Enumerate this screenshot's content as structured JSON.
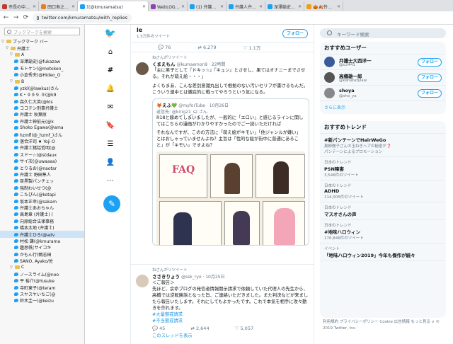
{
  "browser": {
    "tabs": [
      {
        "title": "市長の中止理由ひ",
        "color": "#c0392b"
      },
      {
        "title": "田口寿之介とか藤",
        "color": "#e67e22"
      },
      {
        "title": "ｴ(@kmuramatsu)",
        "color": "#1da1f2",
        "active": true
      },
      {
        "title": "WebLOG 弁護士中村",
        "color": "#8e44ad"
      },
      {
        "title": "(1) 弁護人弁護士",
        "color": "#1da1f2"
      },
      {
        "title": "弁護人弁護士実",
        "color": "#1da1f2"
      },
      {
        "title": "深澤諭史(@fukazaw",
        "color": "#1da1f2"
      },
      {
        "title": "🎃🍂怜奈 富冨口",
        "color": "#f39c12"
      }
    ],
    "url": "twitter.com/kmuramatsu/with_replies"
  },
  "bookmarks": {
    "search_placeholder": "ブックマークを検索",
    "items": [
      {
        "label": "ブックマーク バー",
        "indent": 0,
        "folder": true,
        "exp": "▽"
      },
      {
        "label": "弁護士",
        "indent": 1,
        "folder": true,
        "exp": "▽"
      },
      {
        "label": "A",
        "indent": 2,
        "folder": true,
        "exp": "▽"
      },
      {
        "label": "深澤諭史(@fukazaw",
        "indent": 3
      },
      {
        "label": "モトケン(@motoken_",
        "indent": 3
      },
      {
        "label": "小倉秀夫(@Hideo_O",
        "indent": 3
      },
      {
        "label": "B",
        "indent": 2,
        "folder": true,
        "exp": "▽"
      },
      {
        "label": "yzkl(@lawkus)さん",
        "indent": 3
      },
      {
        "label": "K・９９９.９(@k9",
        "indent": 3
      },
      {
        "label": "森久仁大英(@kis",
        "indent": 3
      },
      {
        "label": "ココテン刑事弁護士",
        "indent": 3
      },
      {
        "label": "弁護士 秋葉原",
        "indent": 3
      },
      {
        "label": "弁護士神前元(@k",
        "indent": 3
      },
      {
        "label": "Shoko Egawa(@ama",
        "indent": 3
      },
      {
        "label": "hzmfl(@_hzmf_)さん",
        "indent": 3
      },
      {
        "label": "落合洋司 ♦ Yoji O",
        "indent": 3
      },
      {
        "label": "弁護士猪話哲明(@",
        "indent": 3
      },
      {
        "label": "スドー☆(@stdaux",
        "indent": 3
      },
      {
        "label": "サイ次(@uwaaaa)",
        "indent": 3
      },
      {
        "label": "とりるお(@naotar",
        "indent": 3
      },
      {
        "label": "弁護士 野田隼人",
        "indent": 3
      },
      {
        "label": "目黒製パンチェッ",
        "indent": 3
      },
      {
        "label": "強制わいせつ(@",
        "indent": 3
      },
      {
        "label": "こたぴん(@kotapi",
        "indent": 3
      },
      {
        "label": "坂本正幸(@sakam",
        "indent": 3
      },
      {
        "label": "弁護士あおちゃん",
        "indent": 3
      },
      {
        "label": "高島章 (弁護士) (",
        "indent": 3
      },
      {
        "label": "向原総合法律事務",
        "indent": 3
      },
      {
        "label": "橋本太地 (弁護士)",
        "indent": 3
      },
      {
        "label": "弁護士ひろ(@adv",
        "indent": 3,
        "selected": true
      },
      {
        "label": "村松 謙(@kmurama",
        "indent": 3
      },
      {
        "label": "趣思帆(サイコキ",
        "indent": 3
      },
      {
        "label": "かもん行(鴨志田",
        "indent": 3
      },
      {
        "label": "SANO, Ayako/佐",
        "indent": 3
      },
      {
        "label": "C",
        "indent": 2,
        "folder": true,
        "exp": "▽"
      },
      {
        "label": "ノースライム(@noo",
        "indent": 3
      },
      {
        "label": "平 裕介(@Yusuke",
        "indent": 3
      },
      {
        "label": "寺町東子(@teram",
        "indent": 3
      },
      {
        "label": "スヤスヤいちご(@",
        "indent": 3
      },
      {
        "label": "鈴木圭一(@keizu",
        "indent": 3
      }
    ]
  },
  "profile": {
    "name": "le",
    "count": "1.5万件のツイート",
    "follow_label": "フォロー"
  },
  "first_actions": [
    "76",
    "6,279",
    "1.1万"
  ],
  "tweet1": {
    "retweet": "ねさんがリツイート",
    "user": "くまえもん",
    "handle": "@kumaemon9 · 22時間",
    "text": "「主に男子として『ドキッ☆』『キュン』とさせし、果てはオナニーまでさせる。それが萌え絵・・・」",
    "text2": "よくもまあ、こんな差別意識丸出しで根拠のない汚いセリフが書けるもんだ。こういう連中とは徹底的に戦ってやろうという気になる。",
    "quote_user": "🦊えふ💚",
    "quote_handle": "@myforTube · 10月26日",
    "quote_reply": "返信先: @kirig21_sz さん",
    "quote_text1": "R18と縁めてしまいましたが、一般的に「エロい」と感じるラインに関してはこちらの漫画がわかりやすかったのでご一読いただければ",
    "quote_text2": "それなんですが、このの方法に「萌え絵がキモい」「他ジャンルが嫌い」とはおしゃっていませんよね？主旨は「性的な絵が街中に普通にあること」が「キモい」ですよね？",
    "comic_title": "FAQ"
  },
  "tweet2": {
    "retweet": "ねさんがリツイート",
    "user": "ささきりょう",
    "handle": "@ssk_ryo · 10月25日",
    "text1": "＜ご報告＞",
    "text2": "先ほど、余命ブログの発信者情報開示請求で依頼していた代理人の先生から、高橋では逆転勝訴となった旨、ご連絡いただきました。また判決などが来ましたら報告いたします。それにしてもよかったです。これで本気を相手に攻々動きを作れます。",
    "hashtags": [
      "#大量懲戒請求",
      "#不当懲戒請求"
    ],
    "actions": [
      "45",
      "2,644",
      "5,057"
    ],
    "thread": "このスレッドを表示"
  },
  "right": {
    "search_placeholder": "キーワード検索",
    "who_title": "おすすめユーザー",
    "who": [
      {
        "name": "弁護士大西洋一",
        "handle": "@o2441",
        "color": "#3a5a99"
      },
      {
        "name": "高橋雄一郎",
        "handle": "@kanatatylaw",
        "color": "#555"
      },
      {
        "name": "shoya",
        "handle": "@sho_ya",
        "color": "#888"
      }
    ],
    "follow_label": "フォロー",
    "more": "さらに表示",
    "trends_title": "おすすめトレンド",
    "trends": [
      {
        "label": "",
        "title": "#新パンテーンでHairWeGo",
        "count": "黒柳徹子さんの玉ねぎヘアの秘密が❓",
        "extra": "パンテーンによるプロモーション"
      },
      {
        "label": "日本のトレンド",
        "title": "PSN障害",
        "count": "3,546件のツイート"
      },
      {
        "label": "日本のトレンド",
        "title": "ADHD",
        "count": "114,005件のツイート"
      },
      {
        "label": "日本のトレンド",
        "title": "マスオさんの声",
        "count": ""
      },
      {
        "label": "日本のトレンド",
        "title": "#地味ハロウィン",
        "count": "176,846件のツイート"
      },
      {
        "label": "イベント",
        "title": "「地味ハロウィン2019」今年も傑作が続々",
        "count": ""
      }
    ],
    "footer": "利用規約  プライバシーポリシー  Cookie  広告情報  もっと見る ∨  © 2019 Twitter, Inc."
  }
}
